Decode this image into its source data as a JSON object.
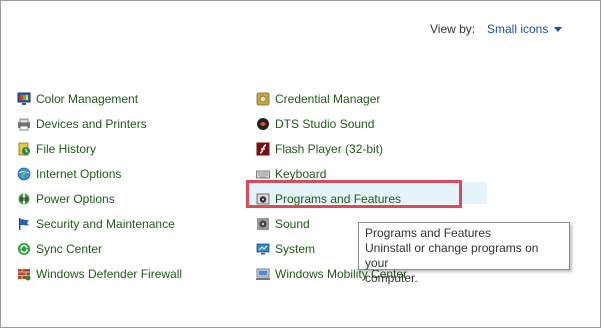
{
  "header": {
    "view_by_label": "View by:",
    "view_by_value": "Small icons"
  },
  "left_items": [
    {
      "label": "Color Management",
      "icon": "color-management-icon"
    },
    {
      "label": "Devices and Printers",
      "icon": "devices-printers-icon"
    },
    {
      "label": "File History",
      "icon": "file-history-icon"
    },
    {
      "label": "Internet Options",
      "icon": "internet-options-icon"
    },
    {
      "label": "Power Options",
      "icon": "power-options-icon"
    },
    {
      "label": "Security and Maintenance",
      "icon": "security-flag-icon"
    },
    {
      "label": "Sync Center",
      "icon": "sync-center-icon"
    },
    {
      "label": "Windows Defender Firewall",
      "icon": "firewall-icon"
    }
  ],
  "right_items": [
    {
      "label": "Credential Manager",
      "icon": "credential-manager-icon"
    },
    {
      "label": "DTS Studio Sound",
      "icon": "dts-sound-icon"
    },
    {
      "label": "Flash Player (32-bit)",
      "icon": "flash-player-icon"
    },
    {
      "label": "Keyboard",
      "icon": "keyboard-icon"
    },
    {
      "label": "Programs and Features",
      "icon": "programs-features-icon"
    },
    {
      "label": "Sound",
      "icon": "sound-icon"
    },
    {
      "label": "System",
      "icon": "system-icon"
    },
    {
      "label": "Windows Mobility Center",
      "icon": "mobility-center-icon"
    }
  ],
  "tooltip": {
    "title": "Programs and Features",
    "line2": "Uninstall or change programs on your",
    "line3": "computer."
  },
  "colors": {
    "link_green": "#1d5b16",
    "accent_blue": "#1a4fa3",
    "highlight_box": "#d94a5a",
    "hover_bg": "#e5f3fb"
  }
}
